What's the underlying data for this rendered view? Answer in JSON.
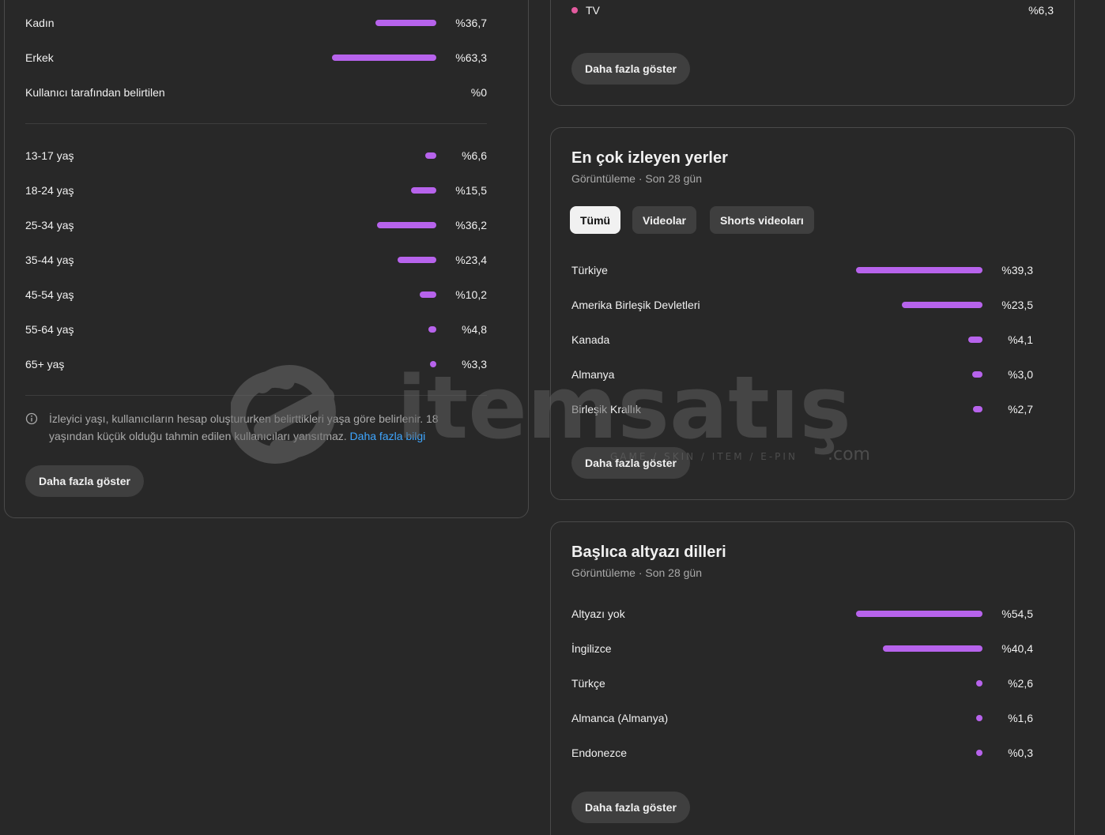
{
  "demographics": {
    "gender": [
      {
        "label": "Kadın",
        "value": "%36,7",
        "pct": 36.7
      },
      {
        "label": "Erkek",
        "value": "%63,3",
        "pct": 63.3
      },
      {
        "label": "Kullanıcı tarafından belirtilen",
        "value": "%0",
        "pct": 0
      }
    ],
    "age": [
      {
        "label": "13-17 yaş",
        "value": "%6,6",
        "pct": 6.6
      },
      {
        "label": "18-24 yaş",
        "value": "%15,5",
        "pct": 15.5
      },
      {
        "label": "25-34 yaş",
        "value": "%36,2",
        "pct": 36.2
      },
      {
        "label": "35-44 yaş",
        "value": "%23,4",
        "pct": 23.4
      },
      {
        "label": "45-54 yaş",
        "value": "%10,2",
        "pct": 10.2
      },
      {
        "label": "55-64 yaş",
        "value": "%4,8",
        "pct": 4.8
      },
      {
        "label": "65+ yaş",
        "value": "%3,3",
        "pct": 3.3
      }
    ],
    "note_text": "İzleyici yaşı, kullanıcıların hesap oluştururken belirttikleri yaşa göre belirlenir. 18 yaşından küçük olduğu tahmin edilen kullanıcıları yansıtmaz.",
    "note_link": "Daha fazla bilgi",
    "more_button": "Daha fazla göster"
  },
  "devices": {
    "rows": [
      {
        "label": "TV",
        "value": "%6,3"
      }
    ],
    "more_button": "Daha fazla göster"
  },
  "locations": {
    "title": "En çok izleyen yerler",
    "subtitle": "Görüntüleme · Son 28 gün",
    "chips": [
      "Tümü",
      "Videolar",
      "Shorts videoları"
    ],
    "active_chip": "Tümü",
    "rows": [
      {
        "label": "Türkiye",
        "value": "%39,3",
        "pct": 39.3
      },
      {
        "label": "Amerika Birleşik Devletleri",
        "value": "%23,5",
        "pct": 23.5
      },
      {
        "label": "Kanada",
        "value": "%4,1",
        "pct": 4.1
      },
      {
        "label": "Almanya",
        "value": "%3,0",
        "pct": 3.0
      },
      {
        "label": "Birleşik Krallık",
        "value": "%2,7",
        "pct": 2.7
      }
    ],
    "more_button": "Daha fazla göster"
  },
  "subtitles": {
    "title": "Başlıca altyazı dilleri",
    "subtitle": "Görüntüleme · Son 28 gün",
    "rows": [
      {
        "label": "Altyazı yok",
        "value": "%54,5",
        "pct": 54.5
      },
      {
        "label": "İngilizce",
        "value": "%40,4",
        "pct": 40.4
      },
      {
        "label": "Türkçe",
        "value": "%2,6",
        "pct": 2.6
      },
      {
        "label": "Almanca (Almanya)",
        "value": "%1,6",
        "pct": 1.6
      },
      {
        "label": "Endonezce",
        "value": "%0,3",
        "pct": 0.3
      }
    ],
    "more_button": "Daha fazla göster"
  },
  "watermark": {
    "brand": "itemsatış",
    "tagline": "GAME / SKIN / ITEM / E-PIN",
    "suffix": ".com"
  },
  "colors": {
    "bar": "#b763ec",
    "tv_dot": "#e35b9f",
    "link": "#3ea6ff",
    "background": "#282828"
  }
}
